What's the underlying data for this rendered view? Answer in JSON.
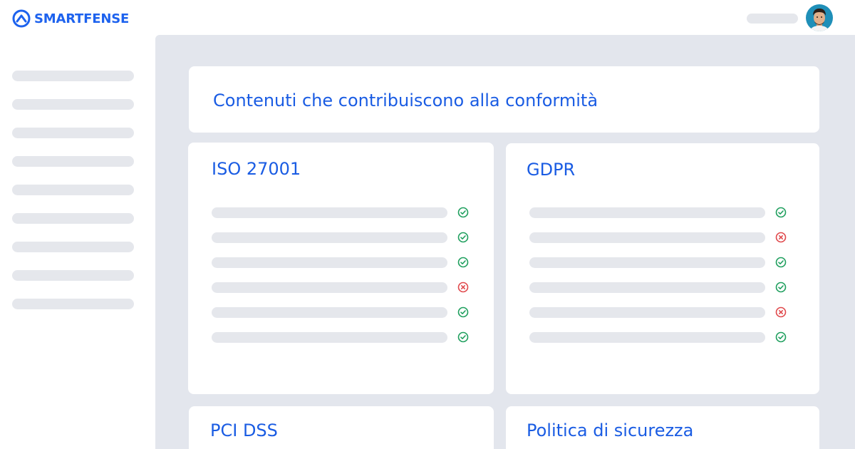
{
  "brand": {
    "name": "SMARTFENSE",
    "color": "#1d62ee"
  },
  "header": {
    "avatar_icon": "user-avatar",
    "placeholder_pill": "account-name-placeholder"
  },
  "sidebar": {
    "item_count": 9
  },
  "main": {
    "title": "Contenuti che contribuiscono alla conformità",
    "cards": [
      {
        "title": "ISO 27001",
        "rows": [
          "ok",
          "ok",
          "ok",
          "fail",
          "ok",
          "ok"
        ]
      },
      {
        "title": "GDPR",
        "rows": [
          "ok",
          "fail",
          "ok",
          "ok",
          "fail",
          "ok"
        ]
      },
      {
        "title": "PCI DSS",
        "rows": []
      },
      {
        "title": "Politica di sicurezza",
        "rows": []
      }
    ]
  },
  "colors": {
    "accent": "#1a5ce3",
    "ok": "#1f9f5e",
    "fail": "#e0494c",
    "placeholder": "#e5e7ec",
    "panel_bg": "#e3e6ed"
  },
  "icons": {
    "ok": "check-circle-icon",
    "fail": "x-circle-icon"
  }
}
